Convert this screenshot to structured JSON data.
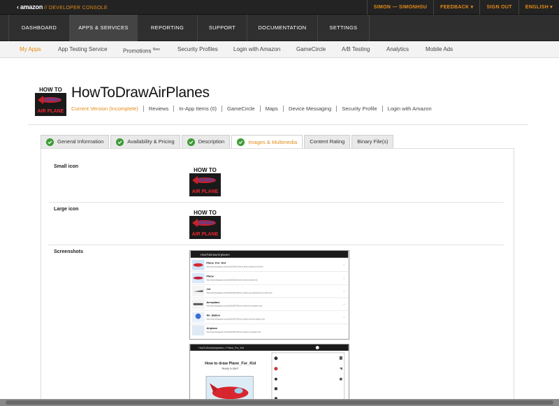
{
  "topbar": {
    "logo": "amazon",
    "console": "// DEVELOPER CONSOLE",
    "user": "SIMON — SIMONHSU",
    "feedback": "FEEDBACK ▾",
    "signout": "SIGN OUT",
    "language": "ENGLISH ▾"
  },
  "mainnav": [
    "DASHBOARD",
    "APPS & SERVICES",
    "REPORTING",
    "SUPPORT",
    "DOCUMENTATION",
    "SETTINGS"
  ],
  "subnav": {
    "items": [
      "My Apps",
      "App Testing Service",
      "Promotions",
      "Security Profiles",
      "Login with Amazon",
      "GameCircle",
      "A/B Testing",
      "Analytics",
      "Mobile Ads"
    ],
    "promotions_badge": "New"
  },
  "app": {
    "title": "HowToDrawAirPlanes",
    "icon_text_top": "HOW TO",
    "icon_text_mid": "DRAW",
    "icon_text_bottom": "AIR PLANE",
    "links": [
      "Current Version (Incomplete)",
      "Reviews",
      "In-App Items (0)",
      "GameCircle",
      "Maps",
      "Device Messaging",
      "Security Profile",
      "Login with Amazon"
    ]
  },
  "tabs": [
    {
      "label": "General Information",
      "checked": true
    },
    {
      "label": "Availability & Pricing",
      "checked": true
    },
    {
      "label": "Description",
      "checked": true
    },
    {
      "label": "Images & Multimedia",
      "checked": true
    },
    {
      "label": "Content Rating",
      "checked": false
    },
    {
      "label": "Binary File(s)",
      "checked": false
    }
  ],
  "sections": {
    "small_icon": "Small icon",
    "large_icon": "Large icon",
    "screenshots": "Screenshots"
  },
  "screenshot1": {
    "header": "HowToDrawAirplanes",
    "items": [
      {
        "title": "Plane_For_Kid",
        "url": "http://www.drawgood.com/club/2014/11/how-to-draw-a-plane-for-kid.htm"
      },
      {
        "title": "Plane",
        "url": "http://www.drawgood.com/club/2013/11/how-to-draw-a-plane.htm"
      },
      {
        "title": "Jet",
        "url": "http://www.drawgood.com/club/2014/07/how-to-draw-a-jet-starting-from-a-circle.htm"
      },
      {
        "title": "Aeroplane",
        "url": "http://www.drawgood.com/club/2014/07/how-to-draw-an-aeroplane.htm"
      },
      {
        "title": "Air_Ballon",
        "url": "http://www.drawgood.com/club/2014/07/how-to-draw-a-hot-air-balloon.htm"
      },
      {
        "title": "Airplane",
        "url": "http://www.drawgood.com/club/2014/07/how-to-draw-an-airplane.htm"
      }
    ]
  },
  "screenshot2": {
    "header": "HowToDrawAirplanes  >  Plane_For_Kid",
    "title": "How to draw Plane_For_Kid",
    "subtitle": "Ready to start?"
  },
  "colors": {
    "accent": "#e48b19",
    "check": "#3d9b35",
    "topbar": "#232323"
  }
}
